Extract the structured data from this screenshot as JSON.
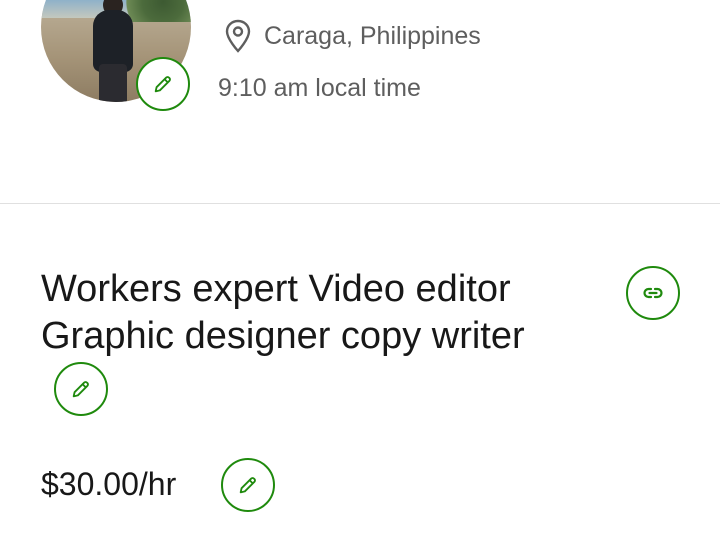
{
  "profile": {
    "location": "Caraga, Philippines",
    "local_time": "9:10 am local time"
  },
  "title": {
    "line1": "Workers expert Video editor",
    "line2": "Graphic designer copy writer"
  },
  "rate": "$30.00/hr",
  "icons": {
    "avatar_edit": "pencil-icon",
    "location": "map-pin-icon",
    "title_link": "link-icon",
    "title_edit": "pencil-icon",
    "rate_edit": "pencil-icon"
  },
  "colors": {
    "accent": "#1f8a0d",
    "secondary_text": "#5e5e5e",
    "primary_text": "#181818"
  }
}
